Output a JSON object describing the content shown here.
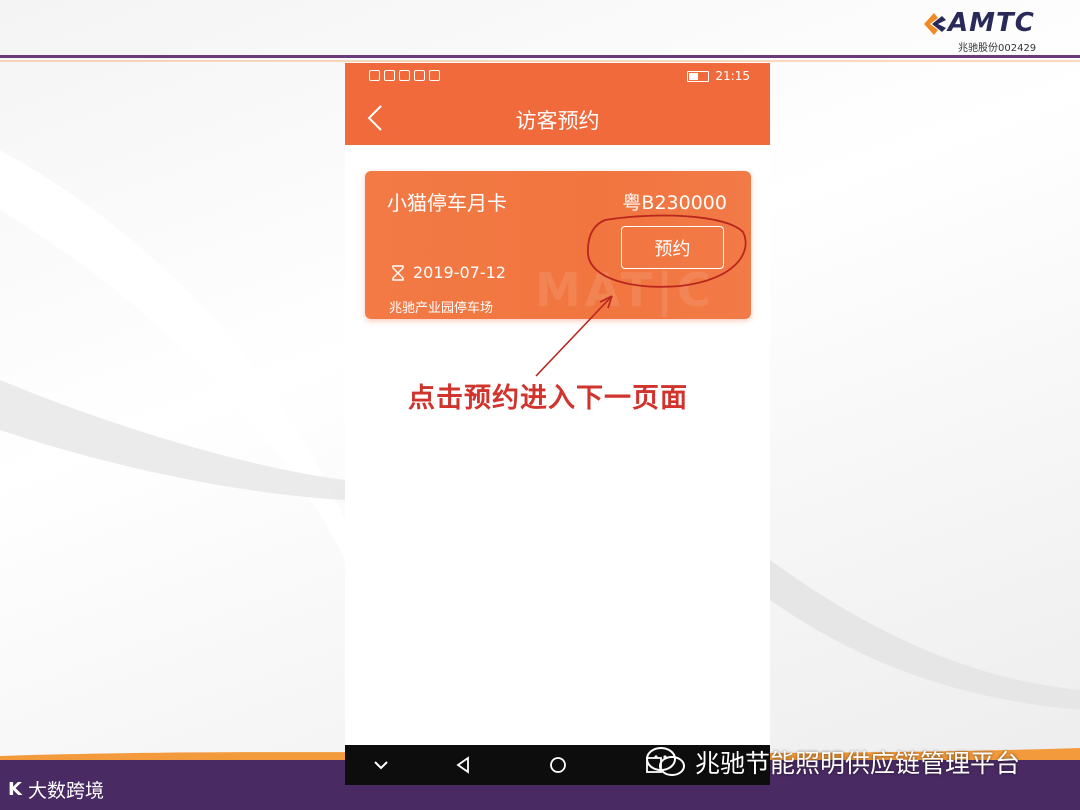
{
  "brand": {
    "logo_text": "AMTC",
    "logo_sub": "兆驰股份002429"
  },
  "phone": {
    "status_time": "21:15",
    "page_title": "访客预约",
    "card": {
      "name": "小猫停车月卡",
      "plate": "粤B230000",
      "button_label": "预约",
      "date": "2019-07-12",
      "lot": "兆驰产业园停车场"
    }
  },
  "annotation": {
    "text": "点击预约进入下一页面"
  },
  "footer": {
    "left_brand": "大数跨境",
    "wechat_text": "兆驰节能照明供应链管理平台"
  },
  "colors": {
    "accent": "#f06a3c",
    "annotation_red": "#d0342c",
    "footer_purple": "#4a2a63"
  }
}
